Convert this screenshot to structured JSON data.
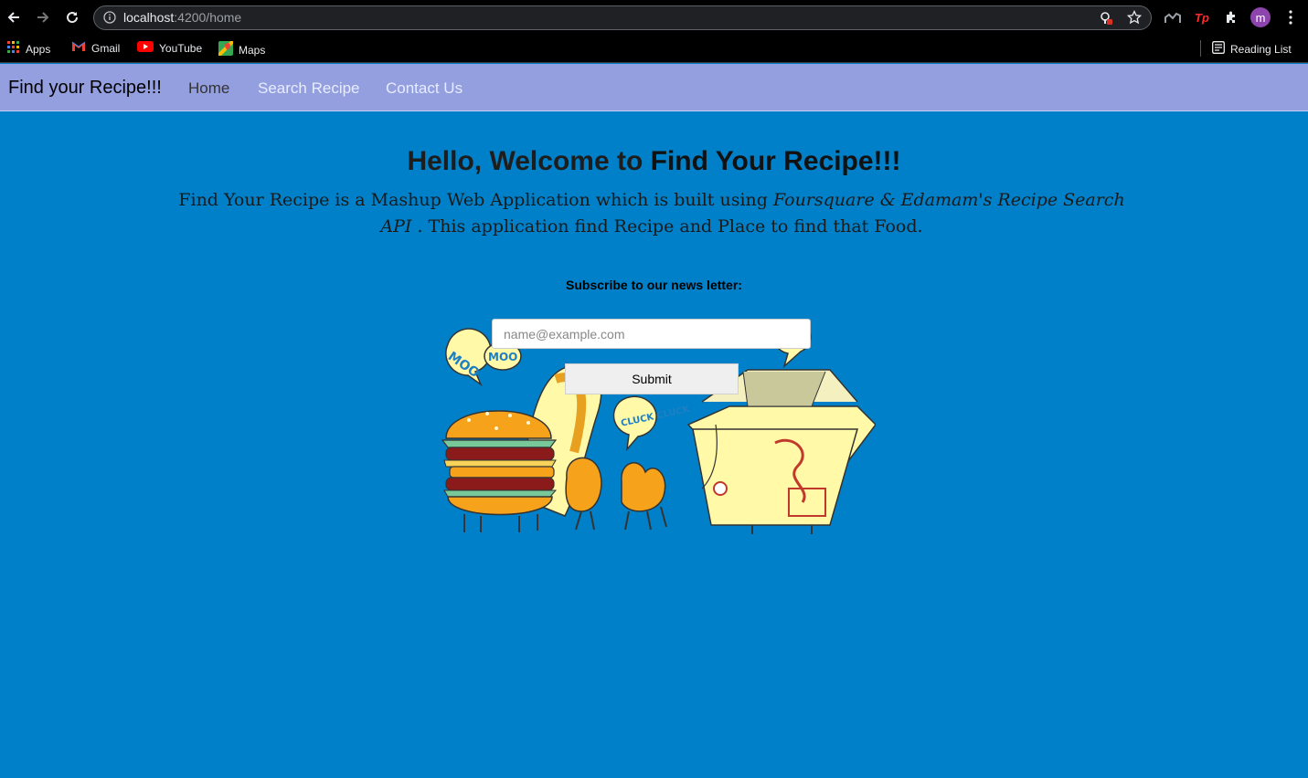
{
  "browser": {
    "url_host": "localhost",
    "url_rest": ":4200/home",
    "bookmarks": [
      {
        "label": "Apps",
        "icon": "apps-grid-icon"
      },
      {
        "label": "Gmail",
        "icon": "gmail-icon"
      },
      {
        "label": "YouTube",
        "icon": "youtube-icon"
      },
      {
        "label": "Maps",
        "icon": "maps-icon"
      }
    ],
    "reading_list": "Reading List",
    "profile_initial": "m",
    "colors": {
      "chrome_bg": "#000000",
      "omnibox_bg": "#202124",
      "profile": "#8e44ad"
    }
  },
  "navbar": {
    "brand": "Find your Recipe!!!",
    "links": [
      "Home",
      "Search Recipe",
      "Contact Us"
    ],
    "active": "Home",
    "bg_color": "#939fdf"
  },
  "hero": {
    "welcome_prefix": "Hello, Welcome to ",
    "welcome_brand": "Find Your Recipe!!!",
    "desc_part1": "Find Your Recipe is a Mashup Web Application which is built using ",
    "desc_api": "Foursquare & Edamam's Recipe Search API",
    "desc_part2": " . This application find Recipe and Place to find that Food.",
    "bg_color": "#0080c9"
  },
  "subscribe": {
    "label": "Subscribe to our news letter:",
    "placeholder": "name@example.com",
    "submit_label": "Submit"
  },
  "illustration": {
    "bubbles": [
      "MOO",
      "MOO",
      "CLUCK CLUCK"
    ]
  }
}
